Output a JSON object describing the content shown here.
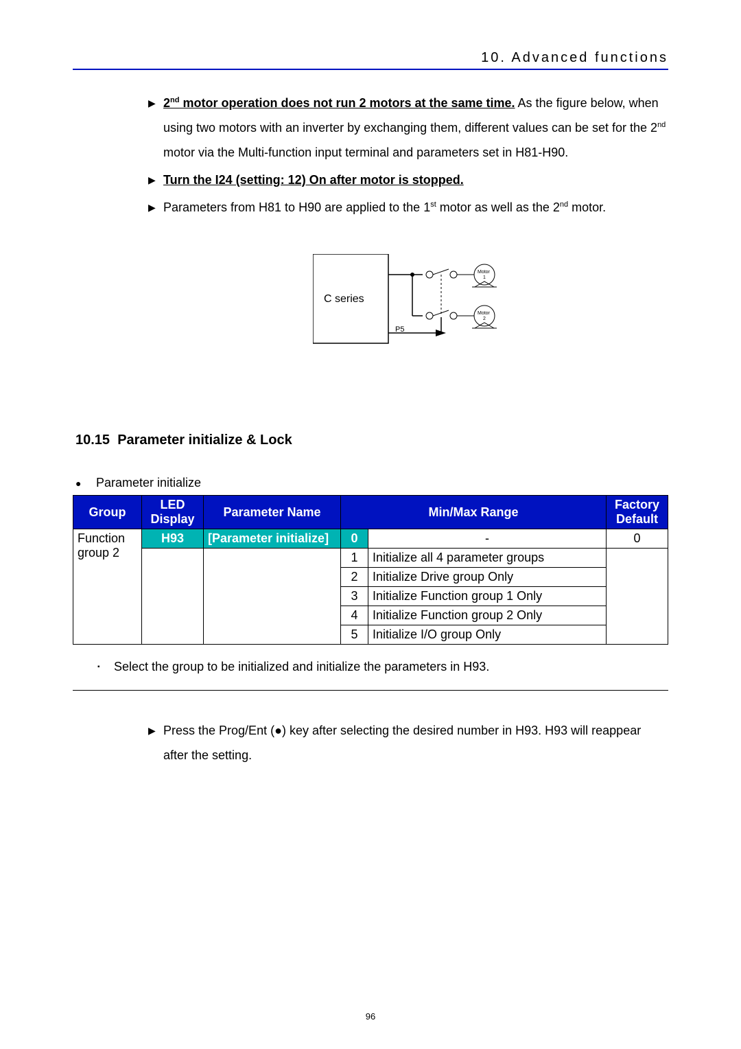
{
  "header": "10. Advanced functions",
  "bullets": {
    "p1_lead_underline": "2",
    "p1_sup": "nd",
    "p1_lead_rest": " motor operation does not run 2 motors at the same time.",
    "p1_tail": " As the figure below, when using two motors with an inverter by exchanging them, different values can be set for the 2",
    "p1_tail_sup": "nd",
    "p1_tail2": " motor via the Multi-function input terminal and parameters set in H81-H90.",
    "p2_underline": "Turn the I24 (setting: 12) On after motor is stopped.",
    "p3_a": "Parameters from H81 to H90 are applied to the 1",
    "p3_sup1": "st",
    "p3_b": " motor as well as the 2",
    "p3_sup2": "nd",
    "p3_c": " motor."
  },
  "diagram": {
    "box_label": "C series",
    "p5": "P5",
    "motor": "Motor",
    "m1": "1",
    "m2": "2"
  },
  "section": {
    "num": "10.15",
    "title": "Parameter initialize & Lock"
  },
  "dot_item": "Parameter initialize",
  "table": {
    "headers": {
      "group": "Group",
      "led": "LED Display",
      "pname": "Parameter Name",
      "range": "Min/Max Range",
      "factory": "Factory Default"
    },
    "group_cell": "Function group 2",
    "led_cell": "H93",
    "pname_cell": "[Parameter initialize]",
    "rows": [
      {
        "n": "0",
        "desc": "-",
        "def": "0"
      },
      {
        "n": "1",
        "desc": "Initialize all 4 parameter groups",
        "def": ""
      },
      {
        "n": "2",
        "desc": "Initialize Drive group Only",
        "def": ""
      },
      {
        "n": "3",
        "desc": "Initialize Function group 1 Only",
        "def": ""
      },
      {
        "n": "4",
        "desc": "Initialize Function group 2 Only",
        "def": ""
      },
      {
        "n": "5",
        "desc": "Initialize I/O group Only",
        "def": ""
      }
    ]
  },
  "sub_bullet": "Select the group to be initialized and initialize the parameters in H93.",
  "note": "Press the Prog/Ent (●) key after selecting the desired number in H93. H93 will reappear after the setting.",
  "page_number": "96"
}
